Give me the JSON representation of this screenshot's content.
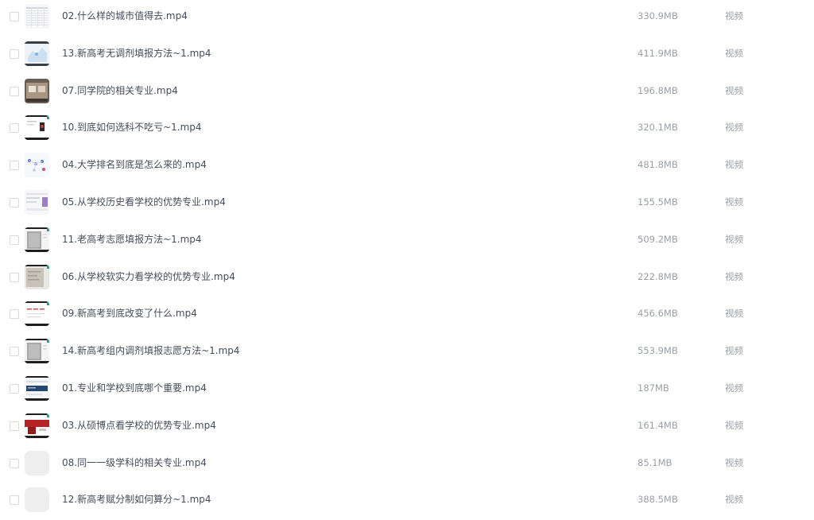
{
  "files": [
    {
      "name": "02.什么样的城市值得去.mp4",
      "size": "330.9MB",
      "type": "视频",
      "thumb": "table"
    },
    {
      "name": "13.新高考无调剂填报方法~1.mp4",
      "size": "411.9MB",
      "type": "视频",
      "thumb": "map"
    },
    {
      "name": "07.同学院的相关专业.mp4",
      "size": "196.8MB",
      "type": "视频",
      "thumb": "photo"
    },
    {
      "name": "10.到底如何选科不吃亏~1.mp4",
      "size": "320.1MB",
      "type": "视频",
      "thumb": "slide-red"
    },
    {
      "name": "04.大学排名到底是怎么来的.mp4",
      "size": "481.8MB",
      "type": "视频",
      "thumb": "diagram"
    },
    {
      "name": "05.从学校历史看学校的优势专业.mp4",
      "size": "155.5MB",
      "type": "视频",
      "thumb": "web-purple"
    },
    {
      "name": "11.老高考志愿填报方法~1.mp4",
      "size": "509.2MB",
      "type": "视频",
      "thumb": "doc-gray"
    },
    {
      "name": "06.从学校软实力看学校的优势专业.mp4",
      "size": "222.8MB",
      "type": "视频",
      "thumb": "paper"
    },
    {
      "name": "09.新高考到底改变了什么.mp4",
      "size": "456.6MB",
      "type": "视频",
      "thumb": "slide-text"
    },
    {
      "name": "14.新高考组内调剂填报志愿方法~1.mp4",
      "size": "553.9MB",
      "type": "视频",
      "thumb": "doc-gray"
    },
    {
      "name": "01.专业和学校到底哪个重要.mp4",
      "size": "187MB",
      "type": "视频",
      "thumb": "web-blue"
    },
    {
      "name": "03.从硕博点看学校的优势专业.mp4",
      "size": "161.4MB",
      "type": "视频",
      "thumb": "red-banner"
    },
    {
      "name": "08.同一一级学科的相关专业.mp4",
      "size": "85.1MB",
      "type": "视频",
      "thumb": "placeholder"
    },
    {
      "name": "12.新高考赋分制如何算分~1.mp4",
      "size": "388.5MB",
      "type": "视频",
      "thumb": "placeholder"
    }
  ]
}
